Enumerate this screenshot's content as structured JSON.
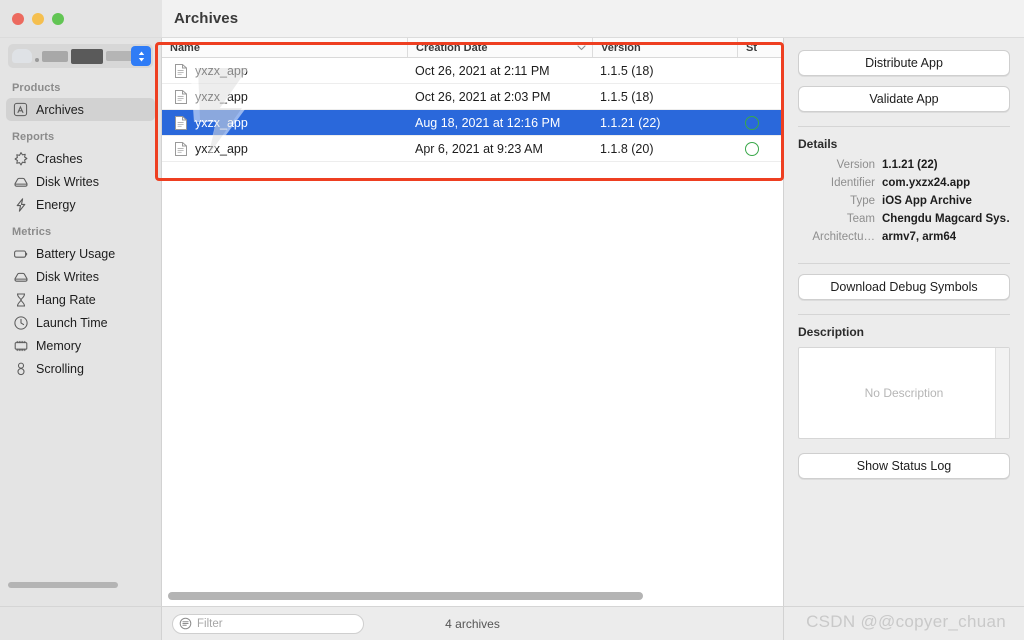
{
  "window": {
    "title": "Archives",
    "traffic_lights": [
      "close",
      "minimize",
      "zoom"
    ]
  },
  "sidebar": {
    "scheme_selector": {
      "label": "",
      "icon": "chevron-updown-icon"
    },
    "sections": [
      {
        "header": "Products",
        "items": [
          {
            "label": "Archives",
            "icon": "archive-box-icon",
            "selected": true
          }
        ]
      },
      {
        "header": "Reports",
        "items": [
          {
            "label": "Crashes",
            "icon": "crash-star-icon",
            "selected": false
          },
          {
            "label": "Disk Writes",
            "icon": "disk-icon",
            "selected": false
          },
          {
            "label": "Energy",
            "icon": "bolt-icon",
            "selected": false
          }
        ]
      },
      {
        "header": "Metrics",
        "items": [
          {
            "label": "Battery Usage",
            "icon": "battery-icon",
            "selected": false
          },
          {
            "label": "Disk Writes",
            "icon": "disk-icon",
            "selected": false
          },
          {
            "label": "Hang Rate",
            "icon": "hourglass-icon",
            "selected": false
          },
          {
            "label": "Launch Time",
            "icon": "clock-icon",
            "selected": false
          },
          {
            "label": "Memory",
            "icon": "memory-chip-icon",
            "selected": false
          },
          {
            "label": "Scrolling",
            "icon": "scroll-icon",
            "selected": false
          }
        ]
      }
    ]
  },
  "table": {
    "columns": [
      {
        "key": "name",
        "label": "Name",
        "sorted": false
      },
      {
        "key": "date",
        "label": "Creation Date",
        "sorted": true,
        "sort_icon": "chevron-down-icon"
      },
      {
        "key": "version",
        "label": "Version",
        "sorted": false
      },
      {
        "key": "status",
        "label": "St",
        "sorted": false
      }
    ],
    "rows": [
      {
        "name": "yxzx_app",
        "date": "Oct 26, 2021 at 2:11 PM",
        "version": "1.1.5 (18)",
        "status": "",
        "selected": false
      },
      {
        "name": "yxzx_app",
        "date": "Oct 26, 2021 at 2:03 PM",
        "version": "1.1.5 (18)",
        "status": "",
        "selected": false
      },
      {
        "name": "yxzx_app",
        "date": "Aug 18, 2021 at 12:16 PM",
        "version": "1.1.21 (22)",
        "status": "uploaded",
        "selected": true
      },
      {
        "name": "yxzx_app",
        "date": "Apr 6, 2021 at 9:23 AM",
        "version": "1.1.8 (20)",
        "status": "uploaded",
        "selected": false
      }
    ]
  },
  "inspector": {
    "distribute_button": "Distribute App",
    "validate_button": "Validate App",
    "details_title": "Details",
    "details": [
      {
        "label": "Version",
        "value": "1.1.21 (22)"
      },
      {
        "label": "Identifier",
        "value": "com.yxzx24.app"
      },
      {
        "label": "Type",
        "value": "iOS App Archive"
      },
      {
        "label": "Team",
        "value": "Chengdu Magcard Sys…"
      },
      {
        "label": "Architectu…",
        "value": "armv7, arm64"
      }
    ],
    "download_button": "Download Debug Symbols",
    "description_title": "Description",
    "description_placeholder": "No Description",
    "status_log_button": "Show Status Log"
  },
  "bottombar": {
    "filter_placeholder": "Filter",
    "filter_icon": "filter-icon",
    "archive_count": "4 archives"
  },
  "overlays": {
    "highlight_box_color": "#ee3f21",
    "watermark": "CSDN @@copyer_chuan"
  }
}
